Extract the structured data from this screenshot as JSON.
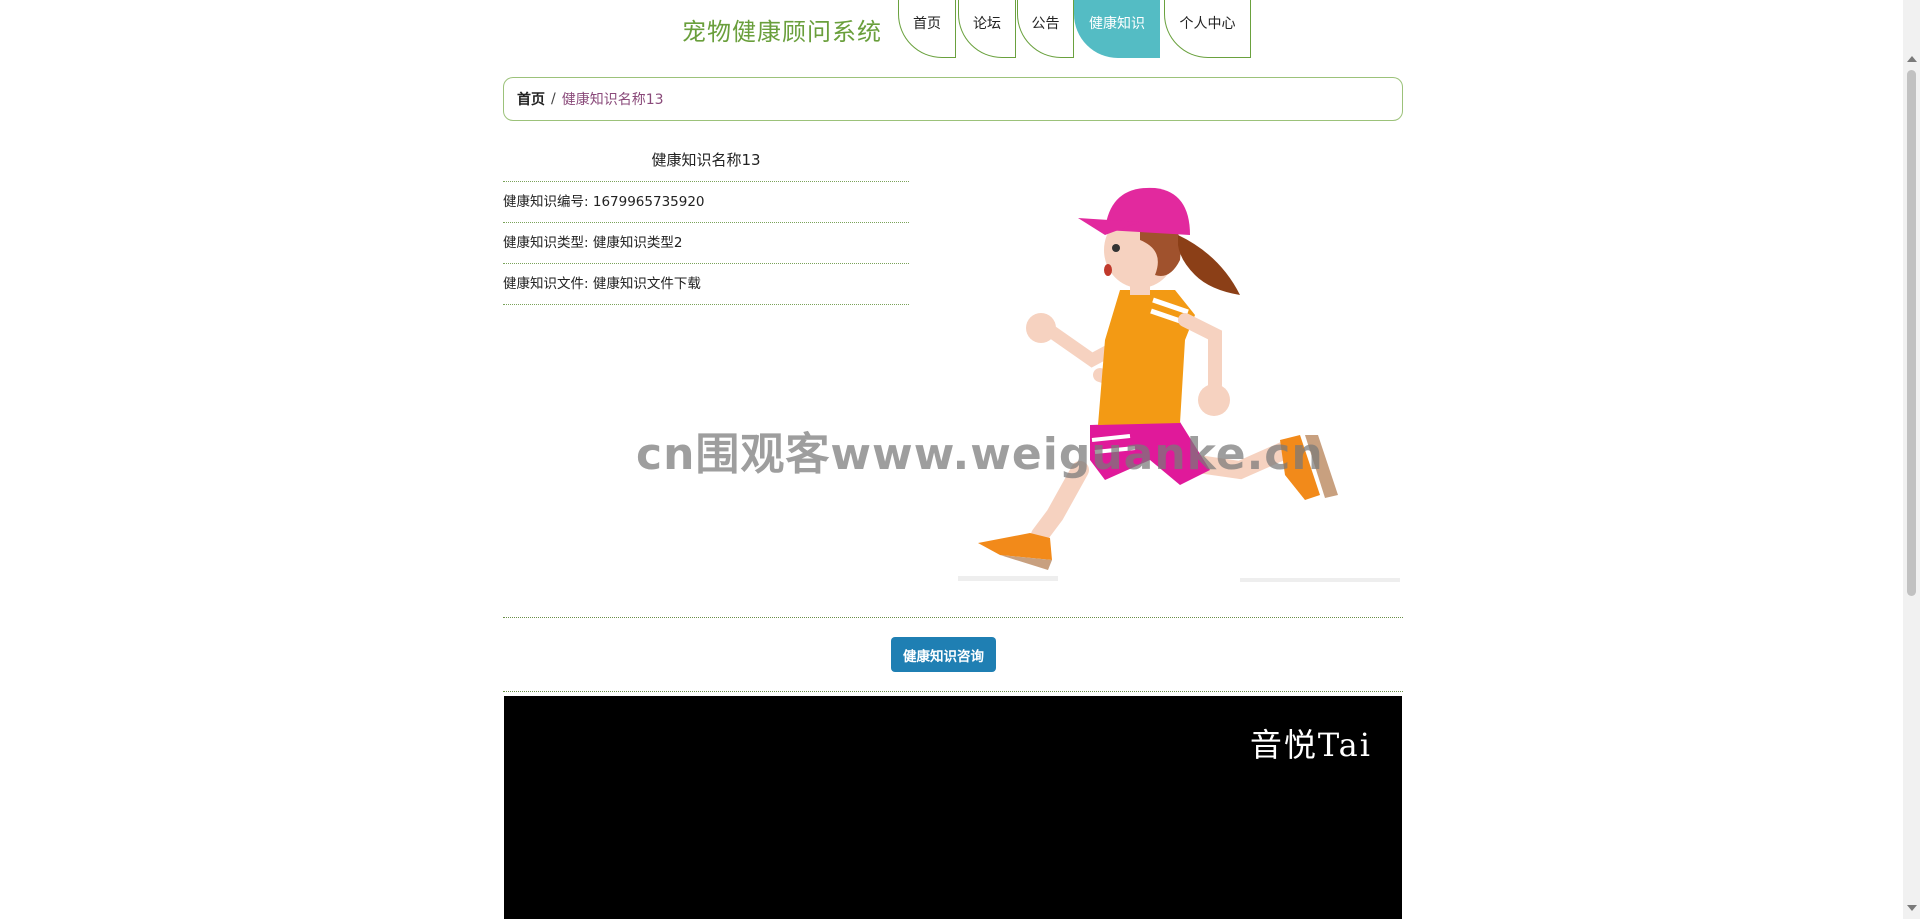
{
  "site": {
    "title": "宠物健康顾问系统"
  },
  "nav": {
    "items": [
      {
        "label": "首页"
      },
      {
        "label": "论坛"
      },
      {
        "label": "公告"
      },
      {
        "label": "健康知识",
        "active": true
      },
      {
        "label": "个人中心"
      }
    ]
  },
  "breadcrumb": {
    "home": "首页",
    "separator": "/",
    "current": "健康知识名称13"
  },
  "detail": {
    "title": "健康知识名称13",
    "rows": [
      {
        "label": "健康知识编号:",
        "value": "1679965735920"
      },
      {
        "label": "健康知识类型:",
        "value": "健康知识类型2"
      },
      {
        "label": "健康知识文件:",
        "value": "健康知识文件下载"
      }
    ]
  },
  "image": {
    "watermark": "cn围观客www.weiguanke.cn"
  },
  "actions": {
    "consult_label": "健康知识咨询"
  },
  "video": {
    "caption": "音悦Tai"
  },
  "colors": {
    "title_green": "#6a9f3c",
    "nav_active": "#54bcc4",
    "button_blue": "#1f7fb3",
    "breadcrumb_current": "#8a4a7a"
  }
}
